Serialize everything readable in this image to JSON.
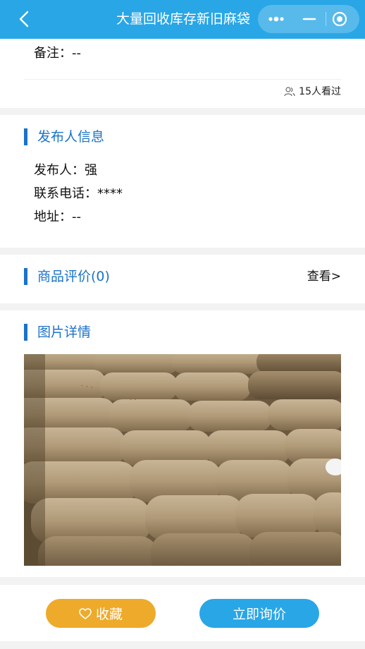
{
  "navbar": {
    "title": "大量回收库存新旧麻袋",
    "back_icon": "chevron-left-icon",
    "more_icon": "more-dots-icon",
    "minimize_icon": "minus-icon",
    "close_icon": "target-circle-icon",
    "bg_color": "#29a6e6"
  },
  "item": {
    "remark_label": "备注：",
    "remark_value": "--",
    "views_text": "15人看过",
    "views_icon": "users-icon"
  },
  "publisher": {
    "section_title": "发布人信息",
    "name_label": "发布人：",
    "name_value": "强",
    "phone_label": "联系电话：",
    "phone_value": "****",
    "address_label": "地址：",
    "address_value": "--"
  },
  "reviews": {
    "section_title": "商品评价(0)",
    "view_label": "查看>"
  },
  "images": {
    "section_title": "图片详情",
    "photo_desc_icon": "burlap-sacks-photo"
  },
  "actions": {
    "favorite_label": "收藏",
    "favorite_icon": "heart-icon",
    "favorite_color": "#eeaa2a",
    "inquire_label": "立即询价",
    "inquire_color": "#29a6e6"
  },
  "colors": {
    "accent": "#1a73c9"
  }
}
